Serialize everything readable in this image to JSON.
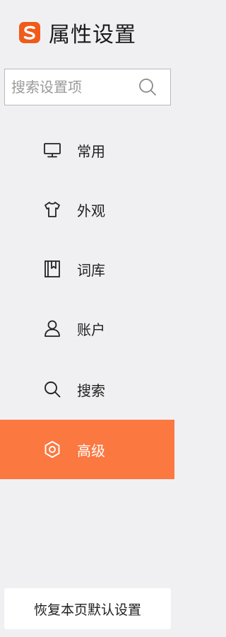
{
  "header": {
    "title": "属性设置"
  },
  "search": {
    "placeholder": "搜索设置项"
  },
  "nav": {
    "items": [
      {
        "label": "常用",
        "icon": "monitor-icon"
      },
      {
        "label": "外观",
        "icon": "shirt-icon"
      },
      {
        "label": "词库",
        "icon": "bookmark-book-icon"
      },
      {
        "label": "账户",
        "icon": "user-icon"
      },
      {
        "label": "搜索",
        "icon": "search-icon"
      },
      {
        "label": "高级",
        "icon": "gear-icon",
        "active": true
      }
    ]
  },
  "footer": {
    "restore_label": "恢复本页默认设置"
  },
  "colors": {
    "accent": "#fb7841",
    "brand": "#f05a1a",
    "background": "#f0f0f2"
  }
}
